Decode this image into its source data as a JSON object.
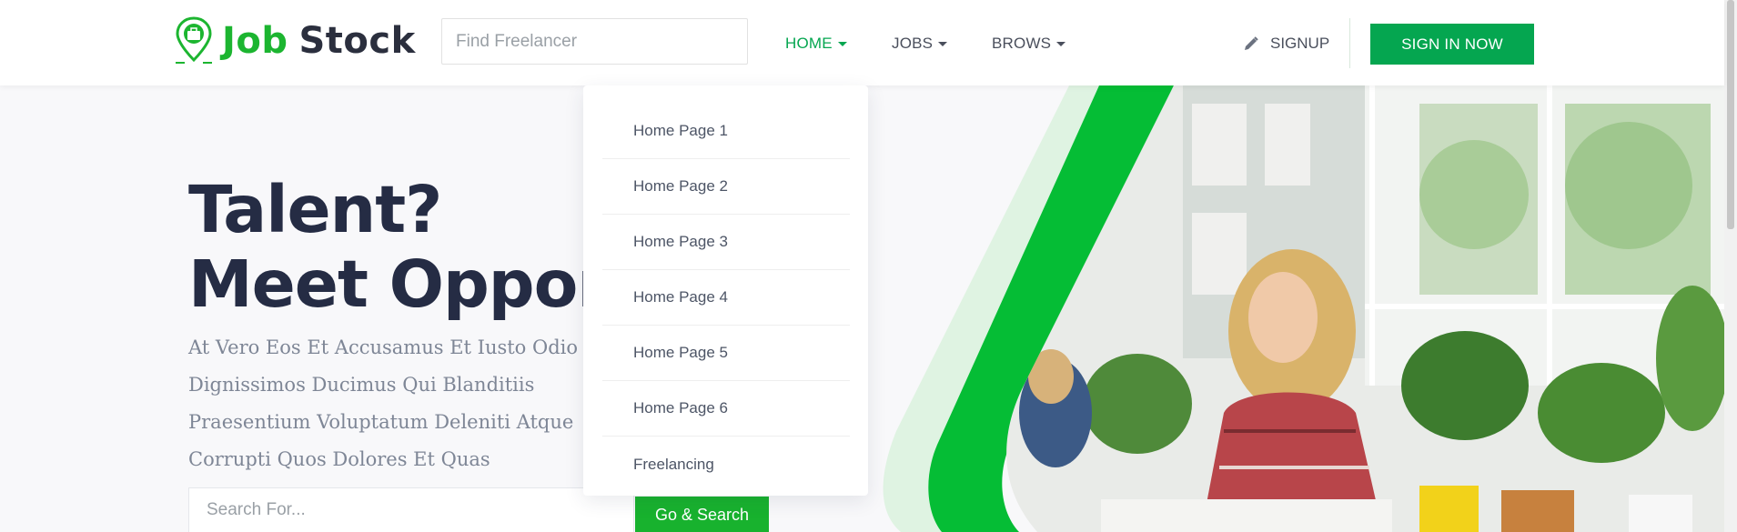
{
  "header": {
    "logo": {
      "word1": "Job",
      "word2": "Stock"
    },
    "find_placeholder": "Find Freelancer",
    "nav": [
      {
        "label": "HOME",
        "active": true
      },
      {
        "label": "JOBS",
        "active": false
      },
      {
        "label": "BROWS",
        "active": false
      }
    ],
    "signup_label": "SIGNUP",
    "signin_label": "SIGN IN NOW"
  },
  "dropdown": {
    "items": [
      "Home Page 1",
      "Home Page 2",
      "Home Page 3",
      "Home Page 4",
      "Home Page 5",
      "Home Page 6",
      "Freelancing"
    ]
  },
  "hero": {
    "headline_line1": "Talent?",
    "headline_line2": "Meet Opportunity.",
    "subtext": "At Vero Eos Et Accusamus Et Iusto Odio Dignissimos Ducimus Qui Blanditiis Praesentium Voluptatum Deleniti Atque Corrupti Quos Dolores Et Quas",
    "search_placeholder": "Search For...",
    "search_button": "Go & Search"
  },
  "colors": {
    "brand_green": "#05a650",
    "logo_green": "#1cb530",
    "headline": "#252c44",
    "text_gray": "#7e8696"
  },
  "icons": [
    "location-pin-briefcase-icon",
    "pencil-icon",
    "chevron-down-icon"
  ]
}
